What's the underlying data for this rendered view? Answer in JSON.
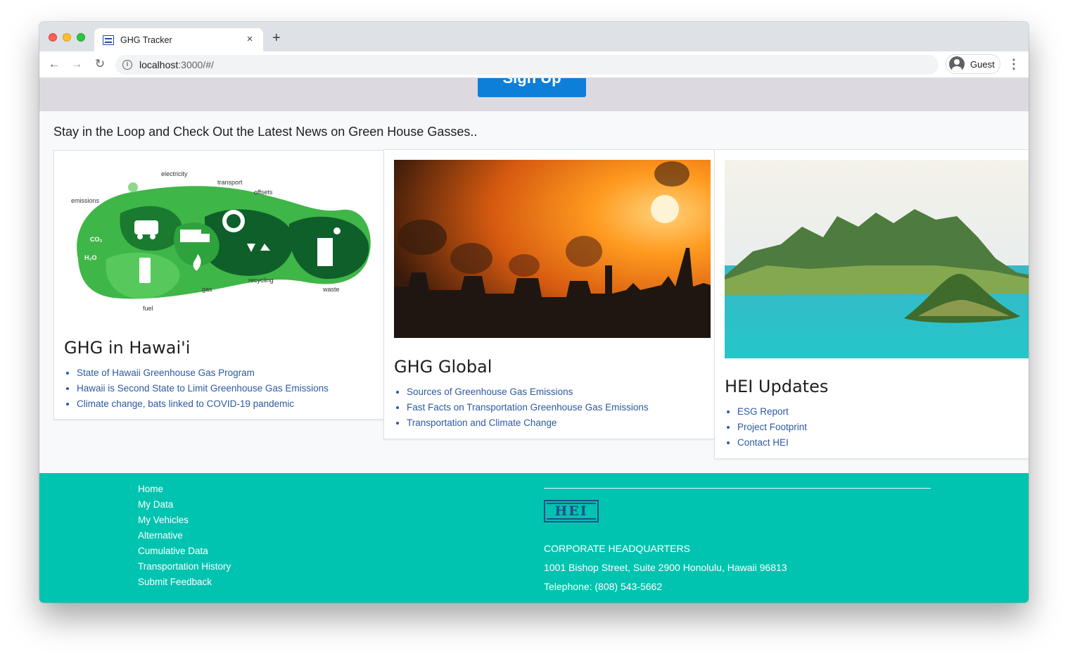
{
  "browser": {
    "tab_title": "GHG Tracker",
    "tab_close": "×",
    "new_tab": "+",
    "url_host": "localhost",
    "url_rest": ":3000/#/",
    "profile_label": "Guest",
    "back": "←",
    "forward": "→",
    "reload": "↻",
    "info": "i",
    "menu": "⋮"
  },
  "signup": {
    "label": "Sign Up"
  },
  "news": {
    "heading": "Stay in the Loop and Check Out the Latest News on Green House Gasses..",
    "cards": [
      {
        "title": "GHG in Hawai'i",
        "image_labels": [
          "electricity",
          "transport",
          "offsets",
          "emissions",
          "gas",
          "recycling",
          "waste",
          "fuel"
        ],
        "links": [
          "State of Hawaii Greenhouse Gas Program",
          "Hawaii is Second State to Limit Greenhouse Gas Emissions",
          "Climate change, bats linked to COVID-19 pandemic"
        ]
      },
      {
        "title": "GHG Global",
        "links": [
          "Sources of Greenhouse Gas Emissions",
          "Fast Facts on Transportation Greenhouse Gas Emissions",
          "Transportation and Climate Change"
        ]
      },
      {
        "title": "HEI Updates",
        "links": [
          "ESG Report",
          "Project Footprint",
          "Contact HEI"
        ]
      }
    ]
  },
  "footer": {
    "links": [
      "Home",
      "My Data",
      "My Vehicles",
      "Alternative",
      "Cumulative Data",
      "Transportation History",
      "Submit Feedback"
    ],
    "logo_text": "HEI",
    "hq_title": "CORPORATE HEADQUARTERS",
    "address": "1001 Bishop Street, Suite 2900 Honolulu, Hawaii 96813",
    "telephone": "Telephone: (808) 543-5662"
  },
  "colors": {
    "footer_bg": "#00c4b0",
    "button_bg": "#0d7fd8",
    "link": "#2c5aa0",
    "logo": "#1d4f8c"
  }
}
